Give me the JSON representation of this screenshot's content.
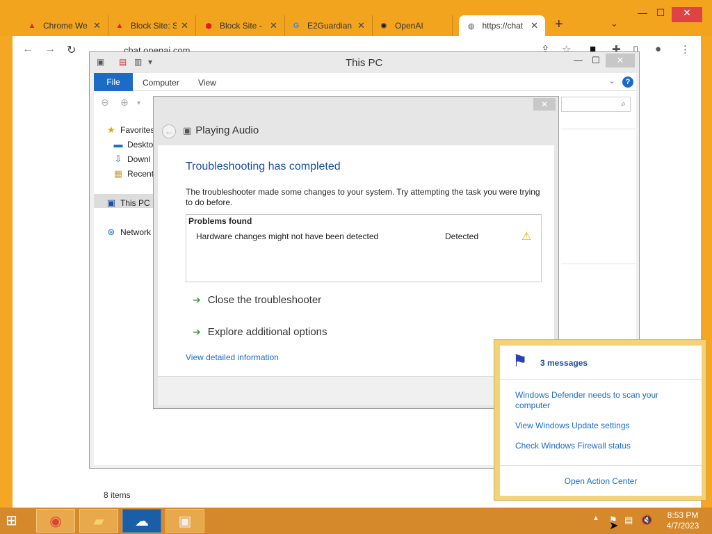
{
  "chrome": {
    "tabs": [
      {
        "label": "Chrome We",
        "icon": "chrome-store-icon"
      },
      {
        "label": "Block Site: S",
        "icon": "chrome-store-icon"
      },
      {
        "label": "Block Site -",
        "icon": "block-site-shield-icon"
      },
      {
        "label": "E2Guardian",
        "icon": "google-icon"
      },
      {
        "label": "OpenAI",
        "icon": "openai-icon"
      },
      {
        "label": "https://chat",
        "icon": "globe-icon"
      }
    ],
    "address": "chat.openai.com"
  },
  "explorer": {
    "title": "This PC",
    "ribbon": {
      "file": "File",
      "tabs": [
        "Computer",
        "View"
      ]
    },
    "tree": [
      "Favorites",
      "Desktop",
      "Downl",
      "Recent",
      "This PC",
      "Network"
    ],
    "status": "8 items"
  },
  "dialog": {
    "title": "Playing Audio",
    "heading": "Troubleshooting has completed",
    "description": "The troubleshooter made some changes to your system. Try attempting the task you were trying to do before.",
    "problems_header": "Problems found",
    "problems": [
      {
        "name": "Hardware changes might not have been detected",
        "status": "Detected"
      }
    ],
    "options": [
      "Close the troubleshooter",
      "Explore additional options"
    ],
    "details_link": "View detailed information",
    "close_label": "✕"
  },
  "action_center": {
    "count": "3 messages",
    "messages": [
      "Windows Defender needs to scan your computer",
      "View Windows Update settings",
      "Check Windows Firewall status"
    ],
    "open_label": "Open Action Center"
  },
  "taskbar": {
    "time": "8:53 PM",
    "date": "4/7/2023"
  }
}
